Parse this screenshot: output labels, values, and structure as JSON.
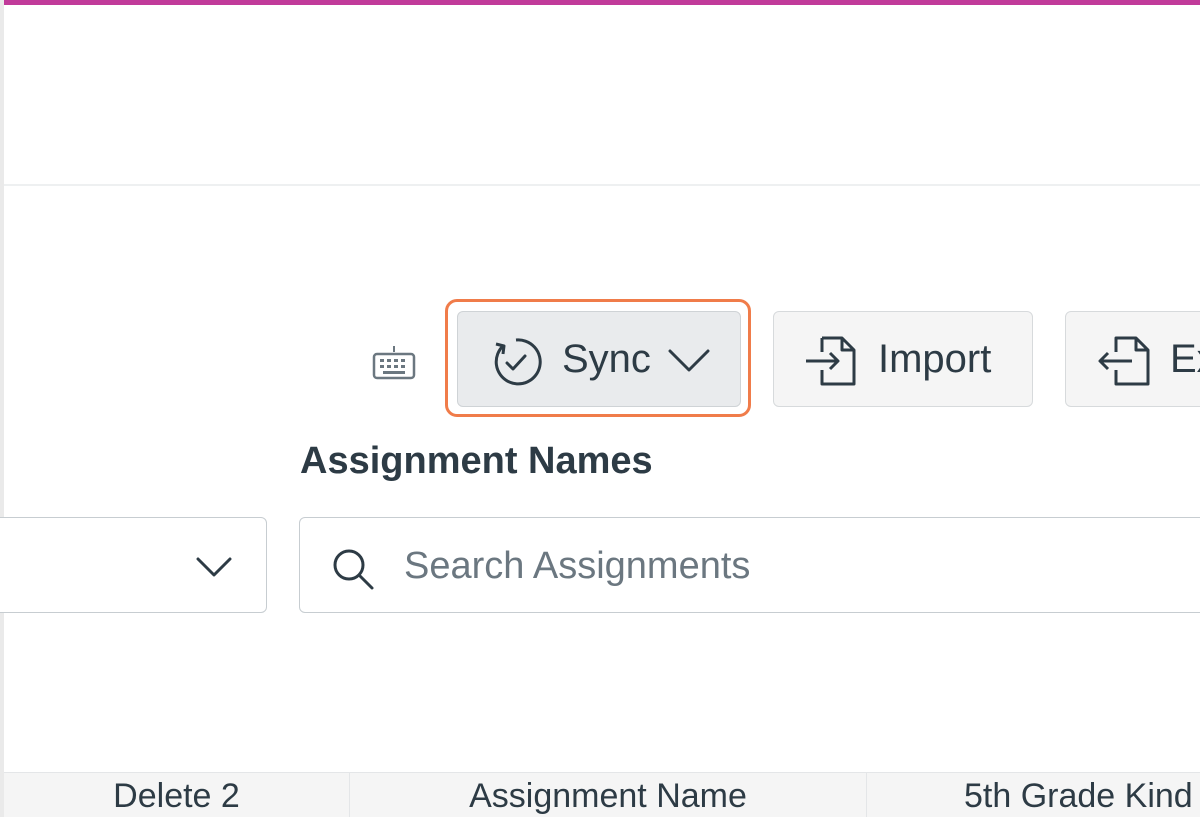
{
  "toolbar": {
    "keyboard_shortcuts_icon": "keyboard-icon",
    "sync_label": "Sync",
    "sync_icon": "sync-icon",
    "sync_dropdown_icon": "chevron-down-icon",
    "import_label": "Import",
    "import_icon": "import-icon",
    "export_label": "Ex",
    "export_icon": "export-icon",
    "highlight_color": "#f07c4a"
  },
  "filters": {
    "select_dropdown_icon": "chevron-down-icon",
    "assignment_names_label": "Assignment Names",
    "search_icon": "search-icon",
    "search_placeholder": "Search Assignments"
  },
  "grid": {
    "columns": [
      "Delete 2",
      "Assignment Name",
      "5th Grade Kind"
    ]
  },
  "colors": {
    "accent_top": "#c13b9a",
    "text": "#2d3b45",
    "placeholder": "#6b7780"
  }
}
